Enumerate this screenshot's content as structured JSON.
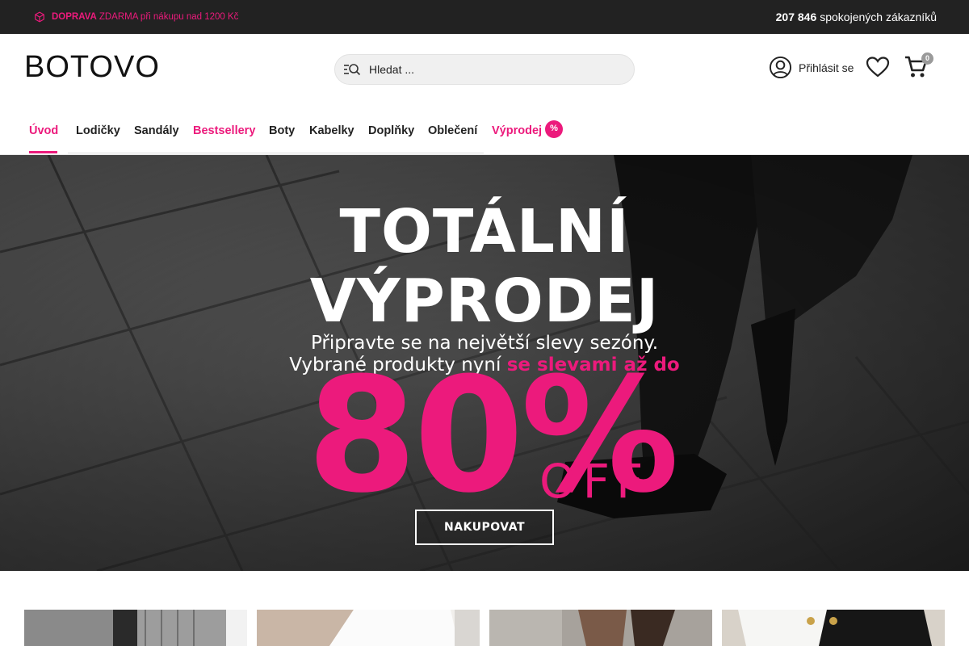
{
  "promo": {
    "bold": "DOPRAVA",
    "text": "ZDARMA při nákupu nad 1200 Kč",
    "icon": "box-icon",
    "color": "#ec1a7c"
  },
  "customers": {
    "count": "207 846",
    "text": "spokojených zákazníků"
  },
  "header": {
    "logo": "BOTOVO",
    "search_placeholder": "Hledat ...",
    "login_label": "Přihlásit se",
    "cart_count": "0"
  },
  "nav": {
    "items": [
      {
        "label": "Úvod"
      },
      {
        "label": "Lodičky"
      },
      {
        "label": "Sandály"
      },
      {
        "label": "Bestsellery"
      },
      {
        "label": "Boty"
      },
      {
        "label": "Kabelky"
      },
      {
        "label": "Doplňky"
      },
      {
        "label": "Oblečení"
      },
      {
        "label": "Výprodej"
      }
    ],
    "sale_badge": "%"
  },
  "hero": {
    "title_line1": "TOTÁLNÍ",
    "title_line2": "VÝPRODEJ",
    "sub_line1": "Připravte se na největší slevy sezóny.",
    "sub_line2_start": "Vybrané produkty nyní",
    "sub_line2_highlight": "se slevami až do",
    "discount": "80%",
    "off": "OFF",
    "cta": "NAKUPOVAT"
  },
  "colors": {
    "accent": "#ec1a7c",
    "topbar": "#222222"
  }
}
